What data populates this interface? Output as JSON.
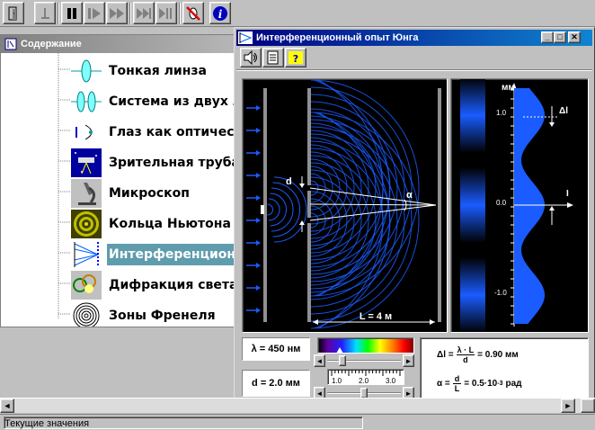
{
  "toolbar": {
    "buttons": [
      "exit-icon",
      "reset-icon",
      "pause-icon",
      "step-forward-icon",
      "fast-forward-icon",
      "step-icon",
      "step-bars-icon",
      "sound-off-icon",
      "info-icon"
    ]
  },
  "toc": {
    "title": "Содержание",
    "items": [
      {
        "label": "Тонкая линза",
        "icon": "thin-lens-icon"
      },
      {
        "label": "Система из двух ли",
        "icon": "two-lens-icon"
      },
      {
        "label": "Глаз как оптический",
        "icon": "eye-icon"
      },
      {
        "label": "Зрительная труба К",
        "icon": "telescope-icon"
      },
      {
        "label": "Микроскоп",
        "icon": "microscope-icon"
      },
      {
        "label": "Кольца Ньютона",
        "icon": "newton-rings-icon"
      },
      {
        "label": "Интерференционны",
        "icon": "interference-icon",
        "selected": true
      },
      {
        "label": "Дифракция света",
        "icon": "diffraction-icon"
      },
      {
        "label": "Зоны Френеля",
        "icon": "fresnel-zones-icon"
      }
    ]
  },
  "window": {
    "title": "Интерференционный опыт Юнга",
    "controls": [
      "minimize",
      "maximize",
      "close"
    ],
    "tools": [
      "sound-icon",
      "document-icon",
      "help-icon"
    ]
  },
  "scene": {
    "d_label": "d",
    "alpha_label": "α",
    "distance_label": "L = 4 м"
  },
  "pattern": {
    "axis_unit": "мм",
    "ticks": [
      "1.0",
      "0.0",
      "-1.0"
    ],
    "delta_label": "Δl",
    "intensity_label": "I",
    "intensity_period": 1
  },
  "controls": {
    "lambda": {
      "text": "λ = 450 нм",
      "value_nm": 450
    },
    "d": {
      "text": "d = 2.0 мм",
      "value_mm": 2.0,
      "ticks": [
        "1.0",
        "2.0",
        "3.0"
      ]
    }
  },
  "results": {
    "delta_lhs": "Δl =",
    "delta_num": "λ · L",
    "delta_den": "d",
    "delta_value": "= 0.90 мм",
    "alpha_lhs": "α =",
    "alpha_num": "d",
    "alpha_den": "L",
    "alpha_value": "= 0.5·10",
    "alpha_exp": "-3",
    "alpha_unit": " рад"
  },
  "status": {
    "text": "Текущие значения"
  },
  "colors": {
    "titlebar": "#000080",
    "selection": "#5f9cad",
    "fringe": "#1a5cff",
    "sim_bg": "#000000"
  }
}
